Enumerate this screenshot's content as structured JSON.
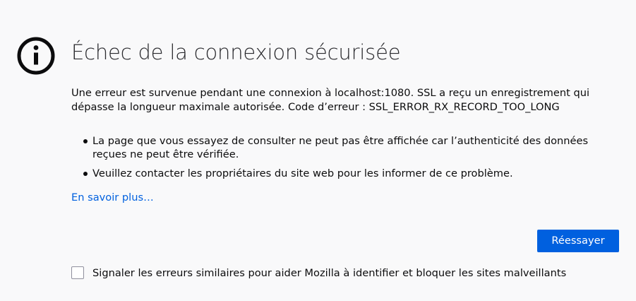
{
  "error": {
    "title": "Échec de la connexion sécurisée",
    "description": "Une erreur est survenue pendant une connexion à localhost:1080. SSL a reçu un enregistrement qui dépasse la longueur maximale autorisée. Code d’erreur : SSL_ERROR_RX_RECORD_TOO_LONG",
    "bullets": [
      "La page que vous essayez de consulter ne peut pas être affichée car l’authenticité des données reçues ne peut être vérifiée.",
      "Veuillez contacter les propriétaires du site web pour les informer de ce problème."
    ],
    "learn_more": "En savoir plus…",
    "retry_label": "Réessayer",
    "report_label": "Signaler les erreurs similaires pour aider Mozilla à identifier et bloquer les sites malveillants",
    "report_checked": false
  },
  "icons": {
    "error_icon": "info-icon"
  },
  "colors": {
    "background": "#f9f9fa",
    "accent": "#0060df",
    "text": "#0c0c0d"
  }
}
